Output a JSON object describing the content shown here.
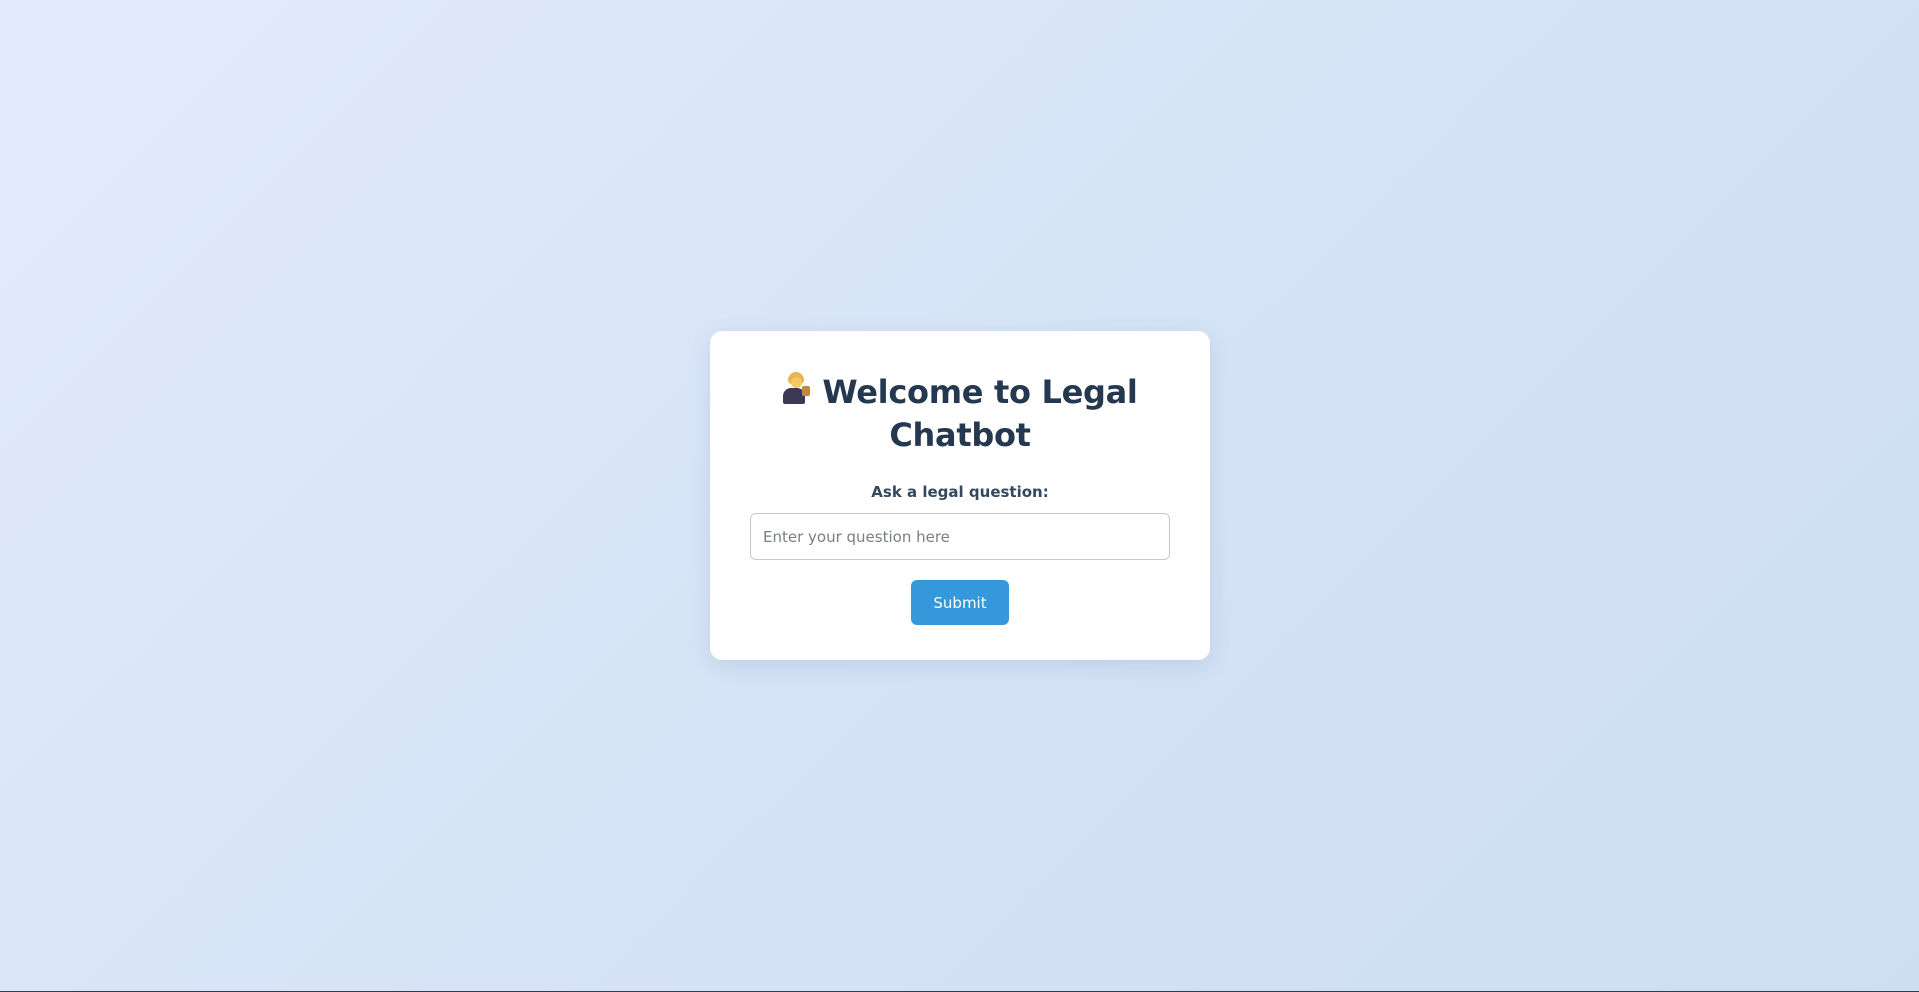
{
  "card": {
    "icon": "judge-icon",
    "title": "Welcome to Legal Chatbot"
  },
  "form": {
    "label": "Ask a legal question:",
    "input_placeholder": "Enter your question here",
    "input_value": "",
    "submit_label": "Submit"
  },
  "colors": {
    "title": "#24384f",
    "button": "#3498db",
    "background_start": "#e2ebfb",
    "background_end": "#cddef3"
  }
}
